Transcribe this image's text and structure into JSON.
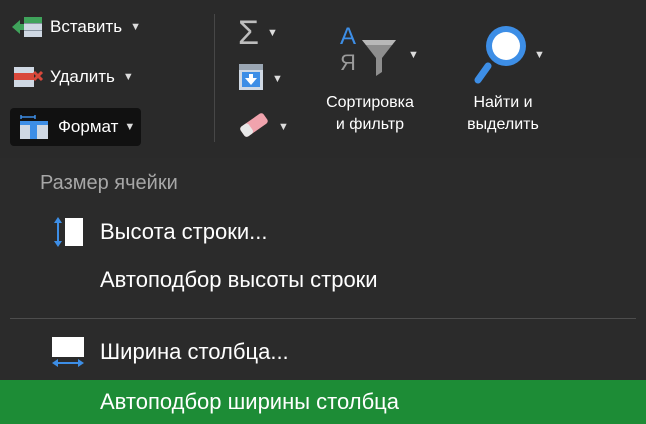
{
  "ribbon": {
    "cells": {
      "insert_label": "Вставить",
      "delete_label": "Удалить",
      "format_label": "Формат"
    },
    "editing": {
      "sort_filter_line1": "Сортировка",
      "sort_filter_line2": "и фильтр",
      "find_select_line1": "Найти и",
      "find_select_line2": "выделить",
      "sort_icon_letters": [
        "А",
        "Я"
      ],
      "autosum_symbol": "Σ"
    }
  },
  "format_menu": {
    "section_heading": "Размер ячейки",
    "items": [
      {
        "label": "Высота строки...",
        "icon": "row-height-icon"
      },
      {
        "label": "Автоподбор высоты строки",
        "icon": ""
      },
      {
        "label": "Ширина столбца...",
        "icon": "column-width-icon"
      },
      {
        "label": "Автоподбор ширины столбца",
        "icon": "",
        "highlighted": true
      }
    ]
  },
  "colors": {
    "highlight": "#1d8c36",
    "ribbon_bg": "#2a2a2a",
    "menu_bg": "#2b2b2b",
    "accent_blue": "#3d8ee6",
    "insert_green": "#3fa35b",
    "delete_red": "#d9483b"
  }
}
